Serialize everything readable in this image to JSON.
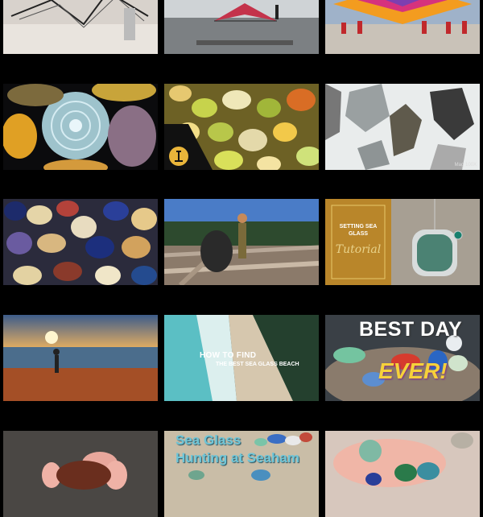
{
  "thumbnails": {
    "how_to_find": {
      "line1": "HOW TO FIND",
      "line2": "THE BEST SEA GLASS BEACH"
    },
    "best_day": {
      "line1": "BEST DAY",
      "line2": "EVER!"
    },
    "setting_tutorial": {
      "line1": "SETTING SEA GLASS",
      "line2": "Tutorial"
    },
    "seaham": {
      "line1": "Sea Glass",
      "line2": "Hunting at Seaham"
    },
    "magnification": {
      "label": "Mag 100X"
    }
  }
}
